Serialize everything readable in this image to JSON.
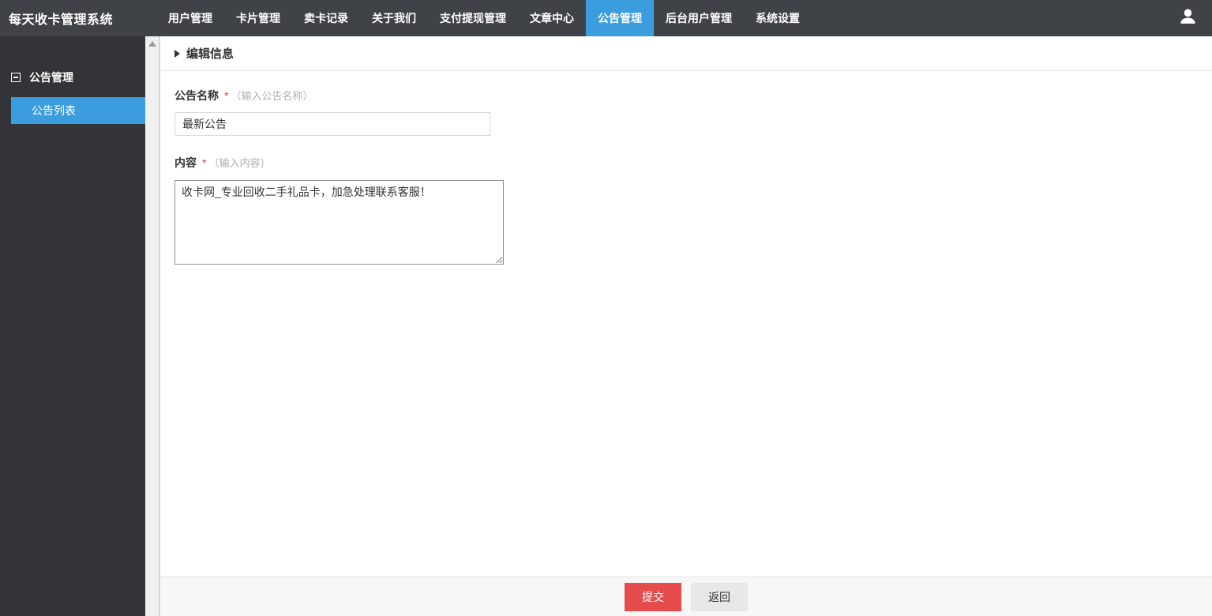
{
  "navbar": {
    "brand": "每天收卡管理系统",
    "items": [
      {
        "label": "用户管理",
        "active": false
      },
      {
        "label": "卡片管理",
        "active": false
      },
      {
        "label": "卖卡记录",
        "active": false
      },
      {
        "label": "关于我们",
        "active": false
      },
      {
        "label": "支付提现管理",
        "active": false
      },
      {
        "label": "文章中心",
        "active": false
      },
      {
        "label": "公告管理",
        "active": true
      },
      {
        "label": "后台用户管理",
        "active": false
      },
      {
        "label": "系统设置",
        "active": false
      }
    ]
  },
  "sidebar": {
    "section_label": "公告管理",
    "items": [
      {
        "label": "公告列表",
        "active": true
      }
    ]
  },
  "content": {
    "header_title": "编辑信息",
    "form": {
      "fields": [
        {
          "label": "公告名称",
          "required_mark": "*",
          "hint": "（输入公告名称）",
          "value": "最新公告"
        },
        {
          "label": "内容",
          "required_mark": "*",
          "hint": "（输入内容）",
          "value": "收卡网_专业回收二手礼品卡，加急处理联系客服！"
        }
      ]
    },
    "footer": {
      "submit_label": "提交",
      "back_label": "返回"
    }
  },
  "colors": {
    "navbar_bg": "#3f4347",
    "sidebar_bg": "#333437",
    "accent_blue": "#3b9ddd",
    "danger_red": "#e74c4c",
    "footer_bg": "#f7f7f7"
  }
}
